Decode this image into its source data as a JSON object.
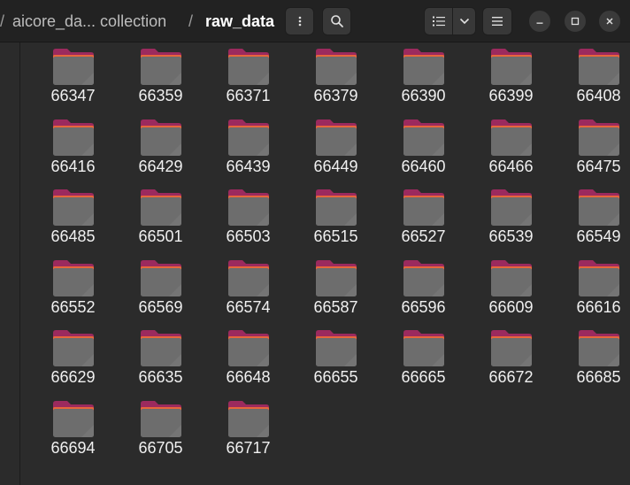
{
  "breadcrumb": {
    "leading_separator": "/",
    "parent": "aicore_da... collection",
    "separator": "/",
    "current": "raw_data"
  },
  "toolbar": {
    "menu_icon": "vertical-dots-icon",
    "search_icon": "search-icon",
    "view_list_icon": "list-view-icon",
    "view_options_icon": "chevron-down-icon",
    "main_menu_icon": "hamburger-icon"
  },
  "window_controls": {
    "minimize_icon": "minimize-icon",
    "maximize_icon": "maximize-icon",
    "close_icon": "close-icon"
  },
  "folder_icon": "folder-icon",
  "colors": {
    "folder_tab": "#9c2a5e",
    "folder_tab_edge": "#e8663c",
    "folder_body": "#6d6d6d",
    "background": "#2b2b2b",
    "headerbar": "#222222"
  },
  "folders": [
    {
      "name": "66347"
    },
    {
      "name": "66359"
    },
    {
      "name": "66371"
    },
    {
      "name": "66379"
    },
    {
      "name": "66390"
    },
    {
      "name": "66399"
    },
    {
      "name": "66408"
    },
    {
      "name": "66416"
    },
    {
      "name": "66429"
    },
    {
      "name": "66439"
    },
    {
      "name": "66449"
    },
    {
      "name": "66460"
    },
    {
      "name": "66466"
    },
    {
      "name": "66475"
    },
    {
      "name": "66485"
    },
    {
      "name": "66501"
    },
    {
      "name": "66503"
    },
    {
      "name": "66515"
    },
    {
      "name": "66527"
    },
    {
      "name": "66539"
    },
    {
      "name": "66549"
    },
    {
      "name": "66552"
    },
    {
      "name": "66569"
    },
    {
      "name": "66574"
    },
    {
      "name": "66587"
    },
    {
      "name": "66596"
    },
    {
      "name": "66609"
    },
    {
      "name": "66616"
    },
    {
      "name": "66629"
    },
    {
      "name": "66635"
    },
    {
      "name": "66648"
    },
    {
      "name": "66655"
    },
    {
      "name": "66665"
    },
    {
      "name": "66672"
    },
    {
      "name": "66685"
    },
    {
      "name": "66694"
    },
    {
      "name": "66705"
    },
    {
      "name": "66717"
    }
  ]
}
